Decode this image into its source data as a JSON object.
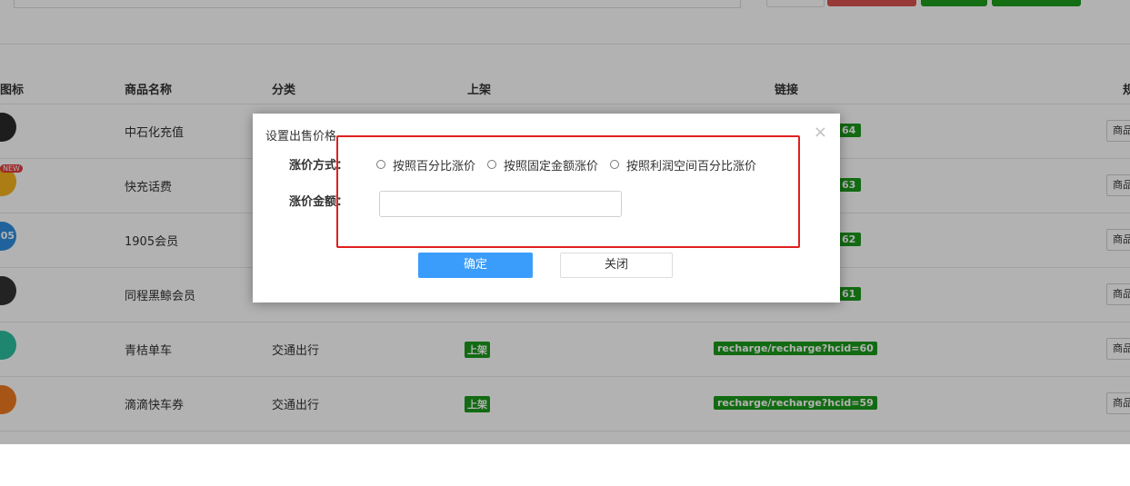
{
  "table": {
    "headers": {
      "icon": "图标",
      "name": "商品名称",
      "category": "分类",
      "shelf": "上架",
      "link": "链接",
      "spec": "规"
    },
    "rows": [
      {
        "name": "中石化充值",
        "category": "",
        "shelf": "",
        "link": "64",
        "op": "商品"
      },
      {
        "name": "快充话费",
        "category": "",
        "shelf": "",
        "link": "63",
        "op": "商品"
      },
      {
        "name": "1905会员",
        "category": "",
        "shelf": "",
        "link": "62",
        "op": "商品"
      },
      {
        "name": "同程黑鲸会员",
        "category": "",
        "shelf": "",
        "link": "61",
        "op": "商品"
      },
      {
        "name": "青桔单车",
        "category": "交通出行",
        "shelf": "上架",
        "link": "recharge/recharge?hcid=60",
        "op": "商品"
      },
      {
        "name": "滴滴快车券",
        "category": "交通出行",
        "shelf": "上架",
        "link": "recharge/recharge?hcid=59",
        "op": "商品"
      }
    ],
    "icon_badge": "NEW",
    "icon_text_1905": "05"
  },
  "dialog": {
    "title": "设置出售价格",
    "close_symbol": "×",
    "method_label": "涨价方式：",
    "amount_label": "涨价金额：",
    "options": [
      "按照百分比涨价",
      "按照固定金额涨价",
      "按照利润空间百分比涨价"
    ],
    "amount_value": "",
    "confirm_label": "确定",
    "close_label": "关闭"
  },
  "colors": {
    "overlay": "rgba(0,0,0,0.30)",
    "primary": "#3b9dfb",
    "badge_green": "#1a9a1a",
    "highlight_red": "#e02020"
  }
}
